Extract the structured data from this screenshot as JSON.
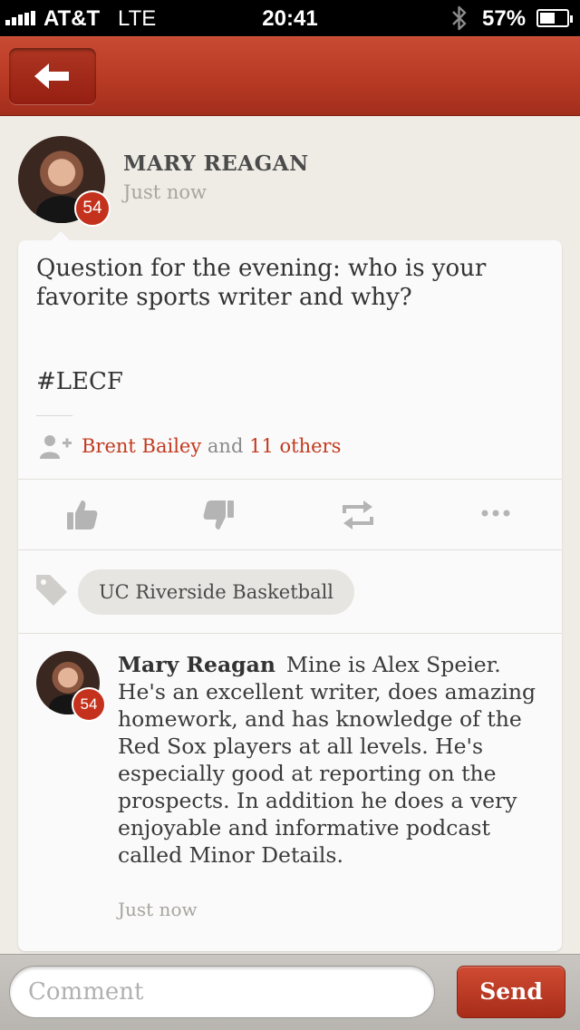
{
  "status_bar": {
    "carrier": "AT&T",
    "network": "LTE",
    "time": "20:41",
    "battery": "57%",
    "battery_level": 0.57,
    "icons": [
      "signal-bars-icon",
      "bluetooth-icon",
      "battery-icon"
    ]
  },
  "nav": {
    "back_icon": "arrow-left-icon"
  },
  "post": {
    "author": "MARY REAGAN",
    "time": "Just now",
    "badge": "54",
    "body": "Question for the evening: who is your favorite sports writer and why?",
    "hashtag": "#LECF",
    "likes": {
      "name": "Brent Bailey",
      "connector": "and",
      "others": "11 others"
    },
    "actions": [
      "thumbs-up-icon",
      "thumbs-down-icon",
      "repost-icon",
      "more-icon"
    ],
    "tag": "UC Riverside Basketball"
  },
  "comment": {
    "author": "Mary Reagan",
    "badge": "54",
    "text": "Mine is Alex Speier. He's an excellent writer, does amazing homework, and has knowledge of the Red Sox players at all levels. He's especially good at reporting on the prospects. In addition he does a very enjoyable and informative podcast called Minor Details.",
    "time": "Just now"
  },
  "composer": {
    "placeholder": "Comment",
    "send_label": "Send"
  },
  "colors": {
    "accent": "#c2391f",
    "nav_bar": "#b83a24",
    "background": "#efece6"
  }
}
